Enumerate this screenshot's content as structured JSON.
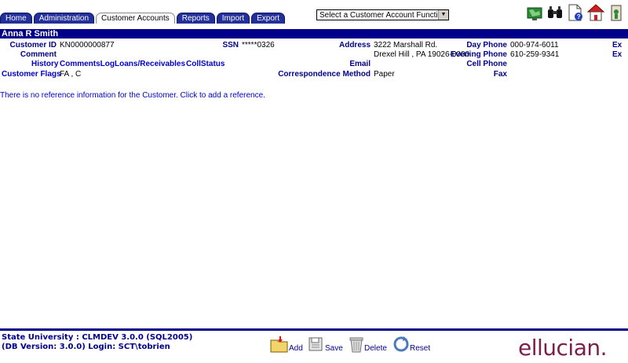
{
  "tabs": [
    "Home",
    "Administration",
    "Customer Accounts",
    "Reports",
    "Import",
    "Export"
  ],
  "active_tab": "Customer Accounts",
  "function_select": {
    "value": "Select a Customer Account Function"
  },
  "customer": {
    "name": "Anna R Smith",
    "customer_id_label": "Customer ID",
    "customer_id": "KN0000000877",
    "ssn_label": "SSN",
    "ssn": "*****0326",
    "address_label": "Address",
    "address_line1": "3222 Marshall Rd.",
    "address_line2": "Drexel Hill , PA 19026-0000",
    "day_phone_label": "Day Phone",
    "day_phone": "000-974-6011",
    "evening_phone_label": "Evening Phone",
    "evening_phone": "610-259-9341",
    "cell_phone_label": "Cell Phone",
    "cell_phone": "",
    "fax_label": "Fax",
    "fax": "",
    "comment_label": "Comment",
    "comment": "",
    "email_label": "Email",
    "email": "",
    "correspondence_label": "Correspondence Method",
    "correspondence": "Paper",
    "flags_label": "Customer Flags",
    "flags": "FA , C",
    "ext1": "Ex",
    "ext2": "Ex"
  },
  "links": {
    "history": "History",
    "comments_log": "CommentsLog",
    "loans": "Loans/Receivables",
    "coll_status": "CollStatus"
  },
  "message": "There is no reference information for the Customer.  Click to add a reference.",
  "footer": {
    "line1": "State University : CLMDEV 3.0.0 (SQL2005)",
    "line2": "(DB Version: 3.0.0) Login: SCT\\tobrien",
    "add": "Add",
    "save": "Save",
    "delete": "Delete",
    "reset": "Reset",
    "logo": "ellucian."
  },
  "colors": {
    "navy": "#00008b",
    "tab": "#24309a",
    "link": "#0000cc",
    "logo": "#7a1f4b"
  }
}
